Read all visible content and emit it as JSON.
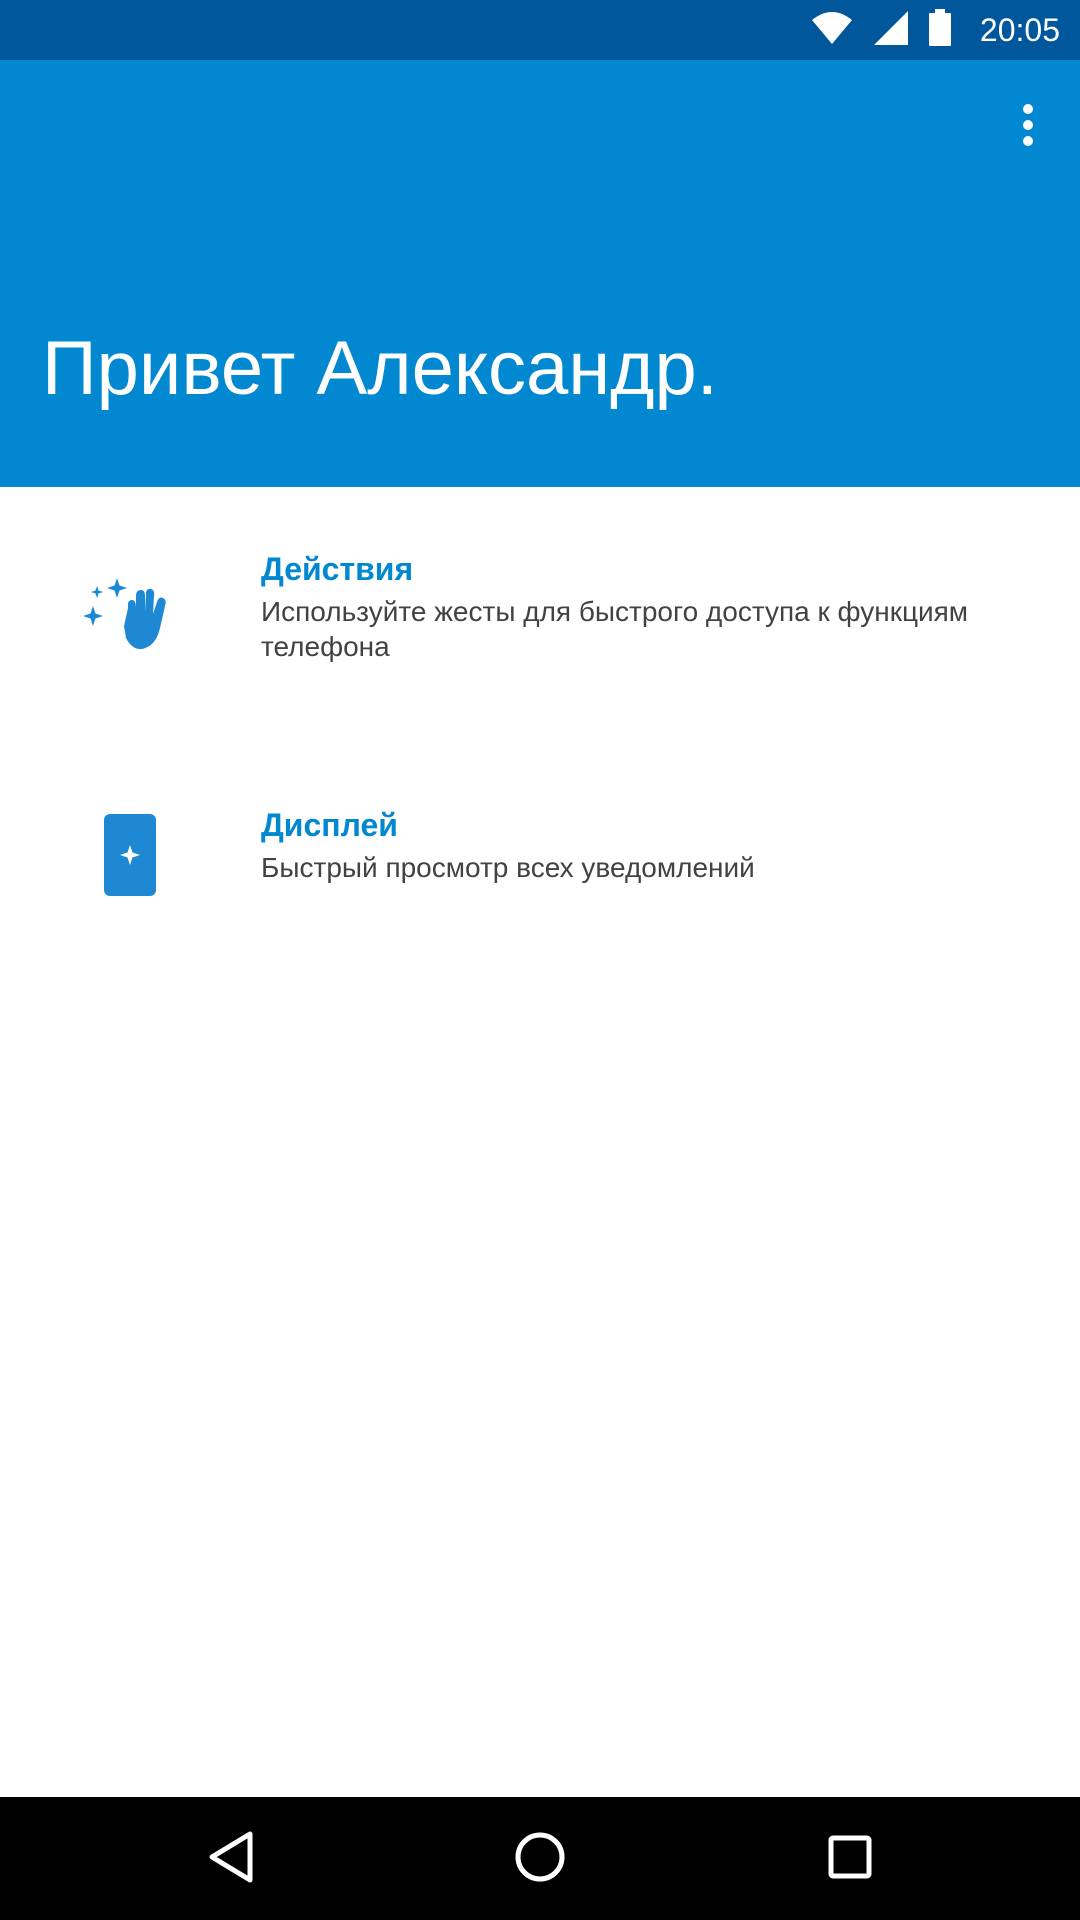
{
  "status_bar": {
    "time": "20:05",
    "icons": [
      "wifi-icon",
      "cell-signal-icon",
      "battery-icon"
    ]
  },
  "header": {
    "greeting": "Привет Александр.",
    "menu_icon": "overflow-menu-icon",
    "background_color": "#0288d1",
    "status_bar_color": "#01579b"
  },
  "items": [
    {
      "icon": "wave-hand-sparkle-icon",
      "title": "Действия",
      "subtitle": "Используйте жесты для быстрого доступа к функциям телефона"
    },
    {
      "icon": "phone-sparkle-icon",
      "title": "Дисплей",
      "subtitle": "Быстрый просмотр всех уведомлений"
    }
  ],
  "nav_bar": {
    "buttons": [
      "back-icon",
      "home-icon",
      "recents-icon"
    ]
  },
  "colors": {
    "accent": "#0288d1",
    "text_secondary": "#424242"
  }
}
